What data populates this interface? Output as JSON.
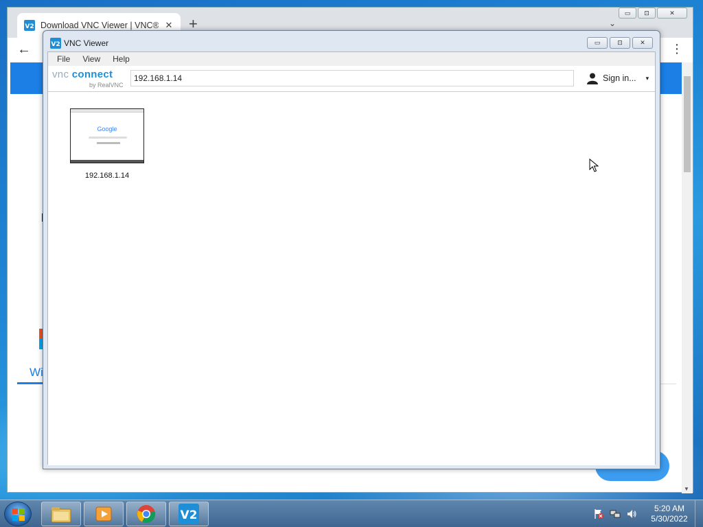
{
  "browser": {
    "tab_title": "Download VNC Viewer | VNC® C",
    "tab_close": "✕",
    "new_tab": "+",
    "tab_menu": "⌄",
    "back": "←",
    "menu": "⋮",
    "win_min": "▭",
    "win_max": "⊡",
    "win_close": "✕",
    "page": {
      "windows_heading_fragment": "Wi"
    }
  },
  "vnc_window": {
    "title": "VNC Viewer",
    "win_min": "▭",
    "win_max": "⊡",
    "win_close": "✕",
    "menu": [
      "File",
      "View",
      "Help"
    ],
    "logo_main_a": "vnc",
    "logo_main_b": "connect",
    "logo_sub": "by RealVNC",
    "address_value": "192.168.1.14",
    "signin_label": "Sign in...",
    "signin_chevron": "▾",
    "connections": [
      {
        "label": "192.168.1.14",
        "thumbnail_logo": "Google"
      }
    ]
  },
  "taskbar": {
    "items": [
      "start-orb",
      "file-explorer-icon",
      "media-player-icon",
      "chrome-icon",
      "vnc-viewer-icon"
    ],
    "clock_time": "5:20 AM",
    "clock_date": "5/30/2022"
  },
  "colors": {
    "vnc_blue": "#1e8fd6",
    "page_blue": "#1b7fe6",
    "taskbar": "#4a7299"
  }
}
